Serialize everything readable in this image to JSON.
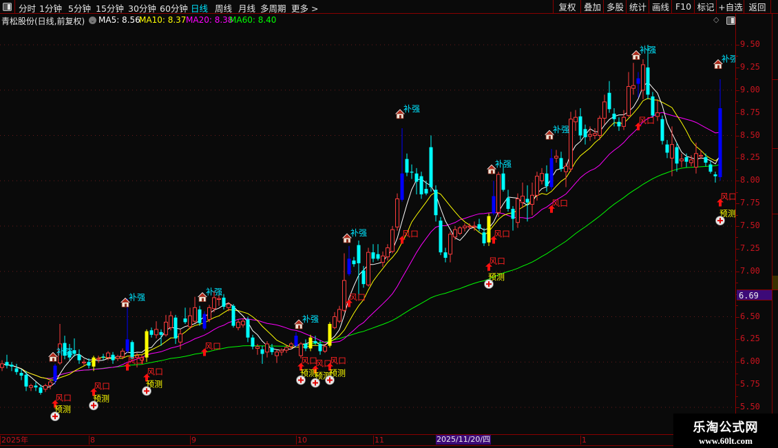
{
  "toolbar": {
    "periods": [
      "分时",
      "1分钟",
      "5分钟",
      "15分钟",
      "30分钟",
      "60分钟",
      "日线",
      "周线",
      "月线",
      "多周期",
      "更多 >"
    ],
    "active_period": "日线",
    "buttons": [
      "复权",
      "叠加",
      "多股",
      "统计",
      "画线",
      "F10",
      "标记",
      "+自选",
      "返回"
    ]
  },
  "info": {
    "title": "青松股份(日线,前复权)",
    "ma5": "MA5: 8.56",
    "ma10": "MA10: 8.37",
    "ma20": "MA20: 8.38",
    "ma60": "MA60: 8.40"
  },
  "colors": {
    "background": "#0a0a0a",
    "up": "#ff3c3c",
    "down": "#00ffff",
    "blue_bar": "#0000ff",
    "yellow_bar": "#ffff00",
    "ma5": "#ffffff",
    "ma10": "#ffff00",
    "ma20": "#ff00ff",
    "ma60": "#00ff00",
    "axis_text": "#c8141e",
    "cursor_bg": "#3c0a78"
  },
  "price_axis": {
    "labels": [
      "9.50",
      "9.25",
      "9.00",
      "8.75",
      "8.50",
      "8.25",
      "8.00",
      "7.75",
      "7.50",
      "7.25",
      "7.00",
      "6.50",
      "6.25",
      "6.00",
      "5.75",
      "5.50"
    ],
    "cursor_price": "6.69"
  },
  "date_axis": {
    "labels": [
      {
        "text": "2025年",
        "bar": 0
      },
      {
        "text": "8",
        "bar": 18
      },
      {
        "text": "9",
        "bar": 39
      },
      {
        "text": "10",
        "bar": 61
      },
      {
        "text": "11",
        "bar": 77
      },
      {
        "text": "1",
        "bar": 120
      }
    ],
    "cursor_date": "2025/11/20/四",
    "cursor_bar": 90
  },
  "watermark": {
    "line1": "乐淘公式网",
    "line2": "www.60lt.com"
  },
  "chart_data": {
    "type": "candlestick",
    "ylim": [
      5.5,
      9.5
    ],
    "grid_every": 0.5,
    "moving_averages": [
      5,
      10,
      20,
      60
    ],
    "ohlc": [
      [
        5.94,
        6.02,
        5.9,
        5.98
      ],
      [
        6.0,
        6.08,
        5.93,
        5.96
      ],
      [
        5.97,
        6.0,
        5.9,
        5.95
      ],
      [
        5.93,
        5.98,
        5.86,
        5.89
      ],
      [
        5.88,
        5.92,
        5.8,
        5.85
      ],
      [
        5.86,
        5.9,
        5.68,
        5.73
      ],
      [
        5.72,
        5.76,
        5.68,
        5.74
      ],
      [
        5.74,
        5.78,
        5.68,
        5.72
      ],
      [
        5.72,
        5.75,
        5.64,
        5.66
      ],
      [
        5.7,
        5.76,
        5.67,
        5.74
      ],
      [
        5.74,
        5.8,
        5.7,
        5.78
      ],
      [
        5.79,
        5.98,
        5.75,
        5.96
      ],
      [
        5.99,
        6.42,
        5.97,
        6.2
      ],
      [
        6.21,
        6.29,
        6.03,
        6.07
      ],
      [
        6.12,
        6.2,
        6.02,
        6.05
      ],
      [
        6.13,
        6.26,
        6.06,
        6.09
      ],
      [
        6.08,
        6.14,
        5.98,
        6.02
      ],
      [
        5.99,
        6.03,
        5.96,
        6.0
      ],
      [
        6.0,
        6.04,
        5.93,
        5.96
      ],
      [
        5.95,
        6.07,
        5.9,
        6.05
      ],
      [
        6.03,
        6.07,
        5.99,
        6.04
      ],
      [
        6.06,
        6.09,
        6.02,
        6.05
      ],
      [
        6.05,
        6.12,
        6.02,
        6.1
      ],
      [
        6.08,
        6.11,
        5.98,
        6.02
      ],
      [
        6.04,
        6.08,
        6.01,
        6.06
      ],
      [
        6.06,
        6.15,
        6.03,
        6.12
      ],
      [
        6.12,
        6.7,
        6.1,
        6.25
      ],
      [
        6.22,
        6.24,
        6.02,
        6.04
      ],
      [
        6.05,
        6.1,
        5.94,
        6.07
      ],
      [
        6.02,
        6.08,
        5.98,
        6.05
      ],
      [
        6.05,
        6.36,
        6.0,
        6.34
      ],
      [
        6.35,
        6.38,
        6.27,
        6.3
      ],
      [
        6.3,
        6.45,
        6.26,
        6.36
      ],
      [
        6.33,
        6.36,
        6.18,
        6.3
      ],
      [
        6.3,
        6.52,
        6.28,
        6.44
      ],
      [
        6.38,
        6.56,
        6.35,
        6.51
      ],
      [
        6.49,
        6.52,
        6.2,
        6.26
      ],
      [
        6.22,
        6.36,
        6.14,
        6.31
      ],
      [
        6.48,
        6.6,
        6.42,
        6.44
      ],
      [
        6.39,
        6.6,
        6.36,
        6.51
      ],
      [
        6.45,
        6.72,
        6.43,
        6.6
      ],
      [
        6.58,
        6.62,
        6.4,
        6.43
      ],
      [
        6.37,
        6.56,
        6.35,
        6.53
      ],
      [
        6.47,
        6.63,
        6.44,
        6.6
      ],
      [
        6.59,
        6.78,
        6.55,
        6.71
      ],
      [
        6.69,
        6.74,
        6.62,
        6.7
      ],
      [
        6.71,
        6.75,
        6.58,
        6.61
      ],
      [
        6.6,
        6.66,
        6.56,
        6.64
      ],
      [
        6.62,
        6.64,
        6.38,
        6.4
      ],
      [
        6.38,
        6.47,
        6.35,
        6.44
      ],
      [
        6.41,
        6.48,
        6.38,
        6.45
      ],
      [
        6.47,
        6.5,
        6.22,
        6.27
      ],
      [
        6.27,
        6.3,
        6.14,
        6.17
      ],
      [
        6.15,
        6.2,
        6.08,
        6.17
      ],
      [
        6.14,
        6.18,
        5.98,
        6.09
      ],
      [
        6.11,
        6.23,
        6.05,
        6.2
      ],
      [
        6.16,
        6.2,
        6.08,
        6.11
      ],
      [
        6.07,
        6.13,
        5.99,
        6.11
      ],
      [
        6.11,
        6.15,
        6.07,
        6.13
      ],
      [
        6.13,
        6.19,
        6.1,
        6.16
      ],
      [
        6.17,
        6.22,
        6.14,
        6.2
      ],
      [
        6.18,
        6.33,
        6.16,
        6.29
      ],
      [
        6.07,
        6.22,
        6.04,
        6.2
      ],
      [
        6.2,
        6.25,
        6.12,
        6.15
      ],
      [
        6.15,
        6.3,
        6.12,
        6.27
      ],
      [
        6.23,
        6.29,
        6.19,
        6.21
      ],
      [
        6.2,
        6.24,
        6.08,
        6.12
      ],
      [
        6.12,
        6.2,
        6.1,
        6.17
      ],
      [
        6.18,
        6.44,
        6.16,
        6.42
      ],
      [
        6.38,
        6.55,
        6.36,
        6.5
      ],
      [
        6.45,
        6.62,
        6.43,
        6.58
      ],
      [
        6.57,
        7.2,
        6.55,
        6.9
      ],
      [
        6.97,
        7.28,
        6.95,
        7.14
      ],
      [
        7.12,
        7.16,
        7.05,
        7.08
      ],
      [
        7.29,
        7.34,
        6.68,
        7.09
      ],
      [
        7.01,
        7.06,
        6.82,
        6.86
      ],
      [
        6.85,
        7.26,
        6.83,
        7.21
      ],
      [
        7.21,
        7.3,
        7.1,
        7.14
      ],
      [
        7.19,
        7.3,
        7.12,
        7.14
      ],
      [
        7.1,
        7.22,
        7.05,
        7.17
      ],
      [
        7.16,
        7.3,
        7.12,
        7.26
      ],
      [
        7.22,
        7.5,
        7.2,
        7.46
      ],
      [
        7.49,
        7.86,
        7.45,
        7.8
      ],
      [
        7.79,
        8.58,
        7.77,
        8.08
      ],
      [
        8.24,
        8.3,
        8.05,
        8.09
      ],
      [
        8.1,
        8.18,
        8.02,
        8.09
      ],
      [
        8.08,
        8.14,
        7.85,
        7.99
      ],
      [
        8.05,
        8.1,
        7.8,
        7.85
      ],
      [
        7.91,
        8.0,
        7.84,
        7.86
      ],
      [
        8.37,
        8.5,
        7.88,
        7.93
      ],
      [
        7.9,
        7.95,
        7.55,
        7.62
      ],
      [
        7.56,
        7.6,
        7.18,
        7.21
      ],
      [
        7.21,
        7.26,
        7.1,
        7.15
      ],
      [
        7.19,
        7.44,
        7.1,
        7.41
      ],
      [
        7.38,
        7.5,
        7.35,
        7.46
      ],
      [
        7.42,
        7.5,
        7.4,
        7.48
      ],
      [
        7.48,
        7.53,
        7.44,
        7.5
      ],
      [
        7.49,
        7.53,
        7.46,
        7.5
      ],
      [
        7.49,
        7.55,
        7.45,
        7.5
      ],
      [
        7.52,
        7.58,
        7.44,
        7.47
      ],
      [
        7.43,
        7.48,
        7.28,
        7.31
      ],
      [
        7.32,
        7.64,
        7.28,
        7.61
      ],
      [
        7.64,
        8.0,
        7.62,
        7.83
      ],
      [
        7.65,
        8.1,
        7.6,
        8.07
      ],
      [
        8.08,
        8.18,
        7.88,
        7.9
      ],
      [
        7.81,
        7.9,
        7.66,
        7.69
      ],
      [
        7.69,
        7.72,
        7.45,
        7.58
      ],
      [
        7.54,
        7.86,
        7.48,
        7.8
      ],
      [
        7.76,
        7.98,
        7.7,
        7.83
      ],
      [
        7.8,
        7.95,
        7.55,
        7.76
      ],
      [
        7.74,
        7.98,
        7.62,
        7.84
      ],
      [
        7.84,
        8.1,
        7.78,
        8.05
      ],
      [
        8.0,
        8.14,
        7.96,
        8.08
      ],
      [
        8.08,
        8.17,
        7.88,
        7.94
      ],
      [
        7.93,
        8.35,
        7.9,
        8.25
      ],
      [
        8.25,
        8.34,
        8.2,
        8.27
      ],
      [
        8.25,
        8.32,
        8.1,
        8.13
      ],
      [
        8.1,
        8.2,
        7.93,
        8.16
      ],
      [
        8.13,
        8.76,
        8.1,
        8.68
      ],
      [
        8.65,
        8.78,
        8.55,
        8.7
      ],
      [
        8.71,
        8.8,
        8.45,
        8.5
      ],
      [
        8.57,
        8.62,
        8.4,
        8.48
      ],
      [
        8.49,
        8.6,
        8.44,
        8.51
      ],
      [
        8.5,
        8.58,
        8.46,
        8.52
      ],
      [
        8.5,
        8.72,
        8.45,
        8.69
      ],
      [
        8.69,
        8.95,
        8.62,
        8.87
      ],
      [
        8.97,
        9.1,
        8.75,
        8.79
      ],
      [
        8.74,
        8.8,
        8.6,
        8.68
      ],
      [
        8.65,
        8.7,
        8.55,
        8.6
      ],
      [
        8.6,
        8.78,
        8.56,
        8.7
      ],
      [
        8.72,
        9.2,
        8.7,
        9.04
      ],
      [
        9.02,
        9.3,
        8.95,
        9.05
      ],
      [
        9.07,
        9.2,
        8.92,
        9.13
      ],
      [
        9.0,
        9.34,
        8.9,
        9.28
      ],
      [
        9.25,
        9.5,
        8.9,
        8.95
      ],
      [
        8.93,
        8.98,
        8.7,
        8.72
      ],
      [
        8.71,
        8.9,
        8.66,
        8.75
      ],
      [
        8.68,
        8.72,
        8.4,
        8.44
      ],
      [
        8.4,
        8.45,
        8.25,
        8.31
      ],
      [
        8.25,
        8.6,
        8.05,
        8.4
      ],
      [
        8.37,
        8.42,
        8.1,
        8.19
      ],
      [
        8.22,
        8.3,
        8.15,
        8.24
      ],
      [
        8.26,
        8.3,
        8.15,
        8.21
      ],
      [
        8.2,
        8.28,
        8.16,
        8.23
      ],
      [
        8.15,
        8.42,
        8.08,
        8.3
      ],
      [
        8.27,
        8.34,
        8.24,
        8.28
      ],
      [
        8.26,
        8.3,
        8.16,
        8.2
      ],
      [
        8.18,
        8.22,
        8.08,
        8.1
      ],
      [
        8.07,
        8.1,
        7.98,
        8.05
      ],
      [
        8.04,
        9.12,
        8.0,
        8.8
      ]
    ],
    "highlight_bars": {
      "blue": [
        11,
        26,
        42,
        61,
        72,
        83,
        102,
        114,
        132,
        149
      ],
      "yellow": [
        19,
        30,
        64,
        68,
        101
      ]
    },
    "signals": {
      "bu_qiang": {
        "label": "补强",
        "points": [
          [
            11,
            6.06
          ],
          [
            26,
            6.66
          ],
          [
            42,
            6.72
          ],
          [
            62,
            6.42
          ],
          [
            72,
            7.37
          ],
          [
            83,
            8.74
          ],
          [
            102,
            8.13
          ],
          [
            114,
            8.51
          ],
          [
            132,
            9.39
          ],
          [
            149,
            9.29
          ]
        ]
      },
      "feng_kou": {
        "label": "风口",
        "points": [
          [
            11,
            5.58
          ],
          [
            19,
            5.71
          ],
          [
            26,
            5.99
          ],
          [
            30,
            5.87
          ],
          [
            42,
            6.15
          ],
          [
            62,
            5.99
          ],
          [
            65,
            5.96
          ],
          [
            68,
            5.99
          ],
          [
            72,
            6.69
          ],
          [
            83,
            7.39
          ],
          [
            101,
            7.09
          ],
          [
            102,
            7.39
          ],
          [
            114,
            7.73
          ],
          [
            132,
            8.64
          ],
          [
            149,
            7.8
          ]
        ]
      },
      "yu_ce": {
        "label": "预测",
        "points": [
          [
            11,
            5.4
          ],
          [
            19,
            5.52
          ],
          [
            30,
            5.68
          ],
          [
            62,
            5.8
          ],
          [
            65,
            5.77
          ],
          [
            68,
            5.8
          ],
          [
            101,
            6.86
          ],
          [
            149,
            7.56
          ]
        ]
      }
    }
  }
}
